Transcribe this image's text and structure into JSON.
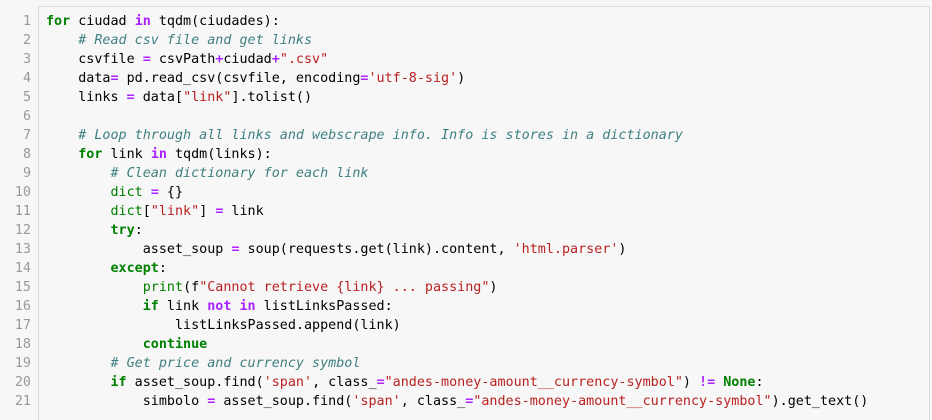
{
  "colors": {
    "keyword": "#008000",
    "string": "#ba2121",
    "comment": "#408080",
    "operator": "#aa22ff",
    "line_number": "#999999",
    "background": "#f7f7f7"
  },
  "code": {
    "lines": [
      [
        {
          "t": "kw",
          "v": "for"
        },
        {
          "t": "tx",
          "v": " ciudad "
        },
        {
          "t": "op",
          "v": "in"
        },
        {
          "t": "tx",
          "v": " tqdm(ciudades):"
        }
      ],
      [
        {
          "t": "tx",
          "v": "    "
        },
        {
          "t": "com",
          "v": "# Read csv file and get links"
        }
      ],
      [
        {
          "t": "tx",
          "v": "    csvfile "
        },
        {
          "t": "op",
          "v": "="
        },
        {
          "t": "tx",
          "v": " csvPath"
        },
        {
          "t": "op",
          "v": "+"
        },
        {
          "t": "tx",
          "v": "ciudad"
        },
        {
          "t": "op",
          "v": "+"
        },
        {
          "t": "str",
          "v": "\".csv\""
        }
      ],
      [
        {
          "t": "tx",
          "v": "    data"
        },
        {
          "t": "op",
          "v": "="
        },
        {
          "t": "tx",
          "v": " pd.read_csv(csvfile, encoding"
        },
        {
          "t": "op",
          "v": "="
        },
        {
          "t": "str",
          "v": "'utf-8-sig'"
        },
        {
          "t": "tx",
          "v": ")"
        }
      ],
      [
        {
          "t": "tx",
          "v": "    links "
        },
        {
          "t": "op",
          "v": "="
        },
        {
          "t": "tx",
          "v": " data["
        },
        {
          "t": "str",
          "v": "\"link\""
        },
        {
          "t": "tx",
          "v": "].tolist()"
        }
      ],
      [],
      [
        {
          "t": "tx",
          "v": "    "
        },
        {
          "t": "com",
          "v": "# Loop through all links and webscrape info. Info is stores in a dictionary"
        }
      ],
      [
        {
          "t": "tx",
          "v": "    "
        },
        {
          "t": "kw",
          "v": "for"
        },
        {
          "t": "tx",
          "v": " link "
        },
        {
          "t": "op",
          "v": "in"
        },
        {
          "t": "tx",
          "v": " tqdm(links):"
        }
      ],
      [
        {
          "t": "tx",
          "v": "        "
        },
        {
          "t": "com",
          "v": "# Clean dictionary for each link"
        }
      ],
      [
        {
          "t": "tx",
          "v": "        "
        },
        {
          "t": "bi",
          "v": "dict"
        },
        {
          "t": "tx",
          "v": " "
        },
        {
          "t": "op",
          "v": "="
        },
        {
          "t": "tx",
          "v": " {}"
        }
      ],
      [
        {
          "t": "tx",
          "v": "        "
        },
        {
          "t": "bi",
          "v": "dict"
        },
        {
          "t": "tx",
          "v": "["
        },
        {
          "t": "str",
          "v": "\"link\""
        },
        {
          "t": "tx",
          "v": "] "
        },
        {
          "t": "op",
          "v": "="
        },
        {
          "t": "tx",
          "v": " link"
        }
      ],
      [
        {
          "t": "tx",
          "v": "        "
        },
        {
          "t": "kw",
          "v": "try"
        },
        {
          "t": "tx",
          "v": ":"
        }
      ],
      [
        {
          "t": "tx",
          "v": "            asset_soup "
        },
        {
          "t": "op",
          "v": "="
        },
        {
          "t": "tx",
          "v": " soup(requests.get(link).content, "
        },
        {
          "t": "str",
          "v": "'html.parser'"
        },
        {
          "t": "tx",
          "v": ")"
        }
      ],
      [
        {
          "t": "tx",
          "v": "        "
        },
        {
          "t": "kw",
          "v": "except"
        },
        {
          "t": "tx",
          "v": ":"
        }
      ],
      [
        {
          "t": "tx",
          "v": "            "
        },
        {
          "t": "bi",
          "v": "print"
        },
        {
          "t": "tx",
          "v": "(f"
        },
        {
          "t": "str",
          "v": "\"Cannot retrieve {link} ... passing\""
        },
        {
          "t": "tx",
          "v": ")"
        }
      ],
      [
        {
          "t": "tx",
          "v": "            "
        },
        {
          "t": "kw",
          "v": "if"
        },
        {
          "t": "tx",
          "v": " link "
        },
        {
          "t": "op",
          "v": "not in"
        },
        {
          "t": "tx",
          "v": " listLinksPassed:"
        }
      ],
      [
        {
          "t": "tx",
          "v": "                listLinksPassed.append(link)"
        }
      ],
      [
        {
          "t": "tx",
          "v": "            "
        },
        {
          "t": "kw",
          "v": "continue"
        }
      ],
      [
        {
          "t": "tx",
          "v": "        "
        },
        {
          "t": "com",
          "v": "# Get price and currency symbol"
        }
      ],
      [
        {
          "t": "tx",
          "v": "        "
        },
        {
          "t": "kw",
          "v": "if"
        },
        {
          "t": "tx",
          "v": " asset_soup.find("
        },
        {
          "t": "str",
          "v": "'span'"
        },
        {
          "t": "tx",
          "v": ", class_"
        },
        {
          "t": "op",
          "v": "="
        },
        {
          "t": "str",
          "v": "\"andes-money-amount__currency-symbol\""
        },
        {
          "t": "tx",
          "v": ") "
        },
        {
          "t": "op",
          "v": "!="
        },
        {
          "t": "tx",
          "v": " "
        },
        {
          "t": "cn",
          "v": "None"
        },
        {
          "t": "tx",
          "v": ":"
        }
      ],
      [
        {
          "t": "tx",
          "v": "            simbolo "
        },
        {
          "t": "op",
          "v": "="
        },
        {
          "t": "tx",
          "v": " asset_soup.find("
        },
        {
          "t": "str",
          "v": "'span'"
        },
        {
          "t": "tx",
          "v": ", class_"
        },
        {
          "t": "op",
          "v": "="
        },
        {
          "t": "str",
          "v": "\"andes-money-amount__currency-symbol\""
        },
        {
          "t": "tx",
          "v": ").get_text()"
        }
      ]
    ]
  }
}
